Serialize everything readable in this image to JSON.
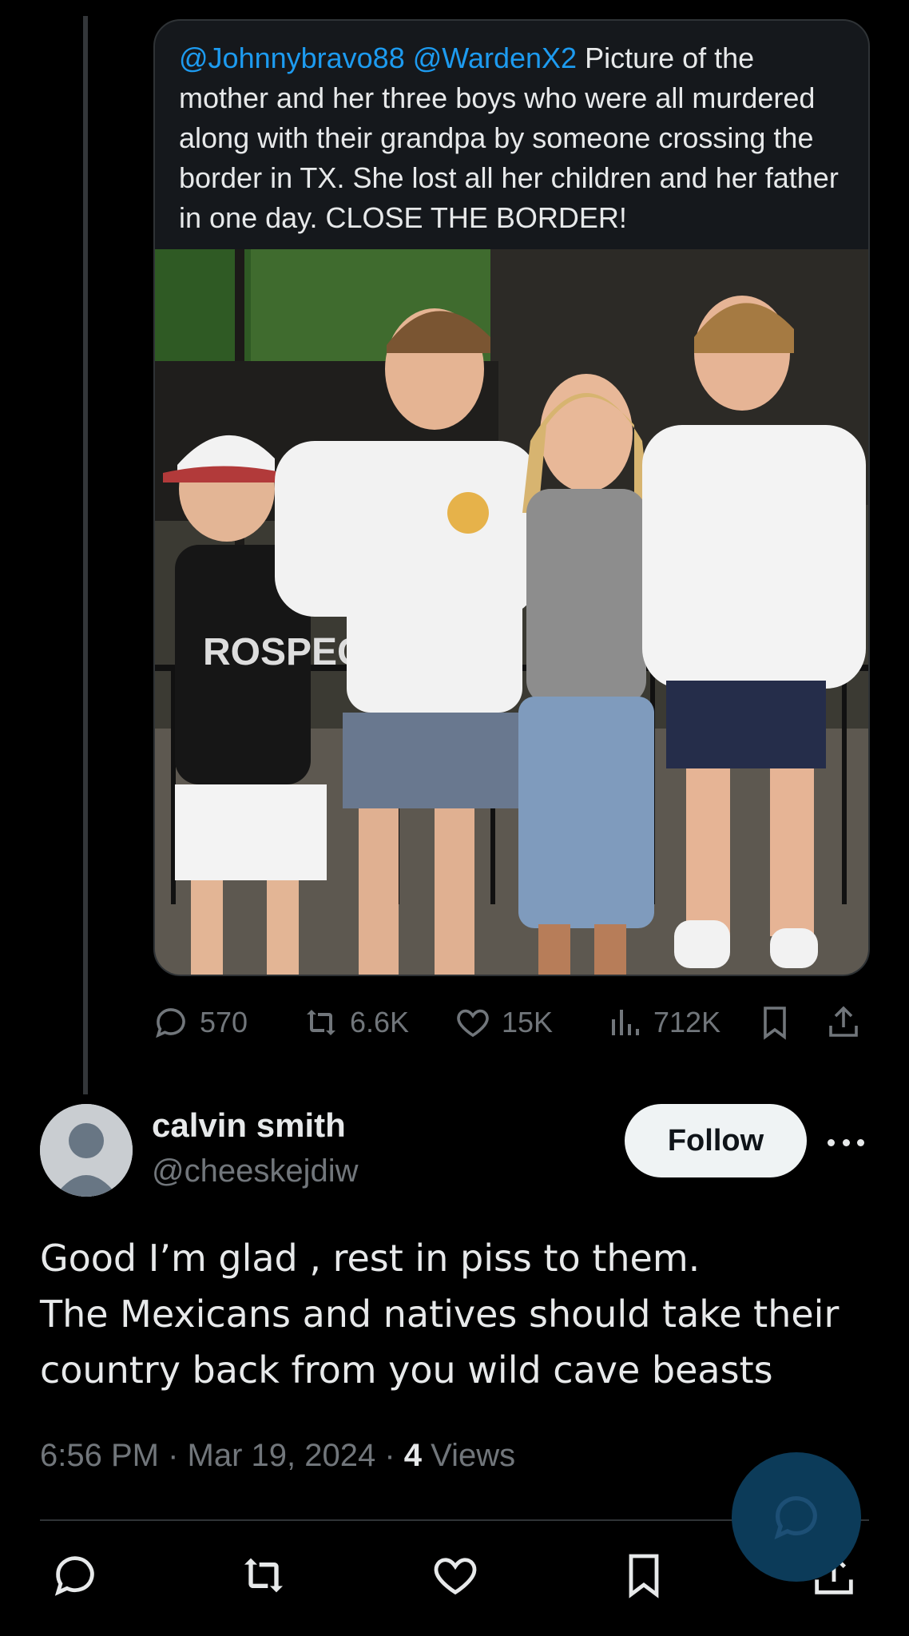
{
  "quoted_tweet": {
    "mentions": [
      "@Johnnybravo88",
      "@WardenX2"
    ],
    "text": "Picture of the mother and her three boys who were all murdered along with their grandpa by someone crossing the border in TX. She lost all her children and her father in one day. CLOSE THE BORDER!",
    "photo_alt": "Photo of a woman with three teenage boys standing in front of a fence",
    "photo_shirt_text": "ROSPECT"
  },
  "metrics": {
    "replies": "570",
    "reposts": "6.6K",
    "likes": "15K",
    "views": "712K"
  },
  "reply": {
    "display_name": "calvin smith",
    "handle": "@cheeskejdiw",
    "follow_label": "Follow",
    "text": "Good I’m glad , rest in piss to them.\nThe Mexicans and natives should take their country back from you wild cave beasts",
    "time": "6:56 PM",
    "date": "Mar 19, 2024",
    "views_count": "4",
    "views_label": "Views"
  },
  "colors": {
    "background": "#000000",
    "mention": "#1d9bf0",
    "muted": "#71767b",
    "text": "#e7e9ea",
    "fab": "#0c3b59"
  },
  "icons": [
    "reply-icon",
    "repost-icon",
    "like-icon",
    "views-icon",
    "bookmark-icon",
    "share-icon",
    "compose-reply-icon",
    "more-icon",
    "avatar-icon"
  ]
}
